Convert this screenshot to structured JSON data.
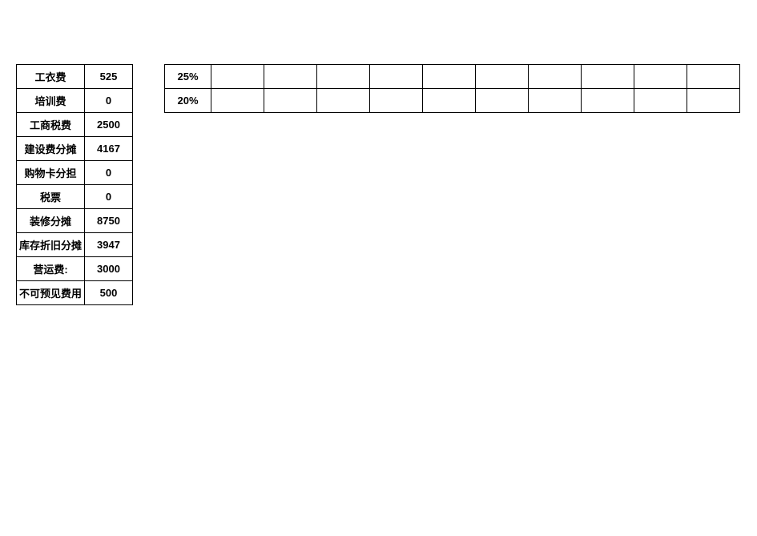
{
  "left_table": {
    "rows": [
      {
        "label": "工衣费",
        "value": "525"
      },
      {
        "label": "培训费",
        "value": "0"
      },
      {
        "label": "工商税费",
        "value": "2500"
      },
      {
        "label": "建设费分摊",
        "value": "4167"
      },
      {
        "label": "购物卡分担",
        "value": "0"
      },
      {
        "label": "税票",
        "value": "0"
      },
      {
        "label": "装修分摊",
        "value": "8750"
      },
      {
        "label": "库存折旧分摊",
        "value": "3947"
      },
      {
        "label": "营运费:",
        "value": "3000"
      },
      {
        "label": "不可预见费用",
        "value": "500"
      }
    ]
  },
  "right_table": {
    "rows": [
      {
        "first": "25%",
        "cells": [
          "",
          "",
          "",
          "",
          "",
          "",
          "",
          "",
          "",
          ""
        ]
      },
      {
        "first": "20%",
        "cells": [
          "",
          "",
          "",
          "",
          "",
          "",
          "",
          "",
          "",
          ""
        ]
      }
    ]
  }
}
